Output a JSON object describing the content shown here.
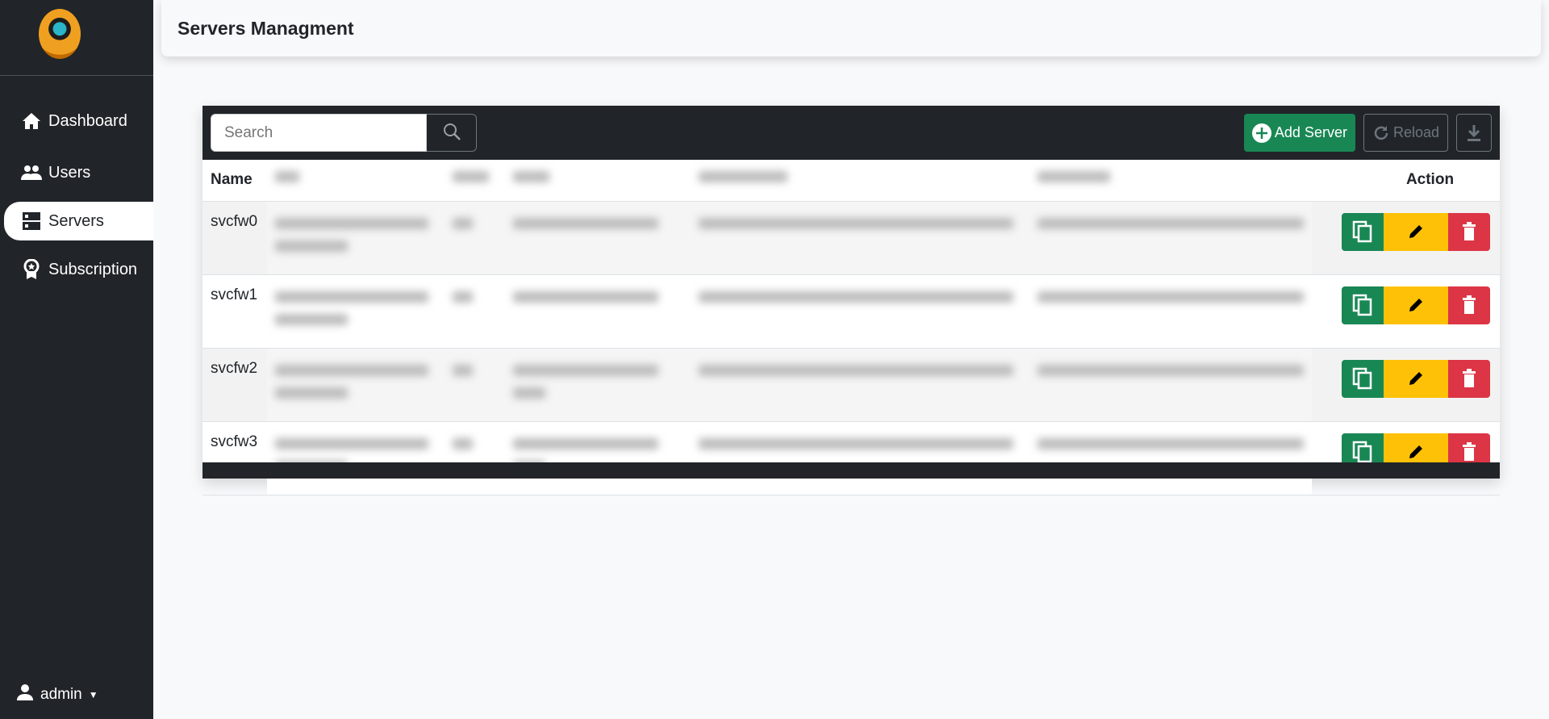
{
  "sidebar": {
    "items": [
      {
        "label": "Dashboard",
        "icon": "home-icon"
      },
      {
        "label": "Users",
        "icon": "users-icon"
      },
      {
        "label": "Servers",
        "icon": "server-icon",
        "active": true
      },
      {
        "label": "Subscription",
        "icon": "award-icon"
      }
    ],
    "user": "admin"
  },
  "header": {
    "title": "Servers Managment"
  },
  "toolbar": {
    "search_placeholder": "Search",
    "add_label": "Add Server",
    "reload_label": "Reload"
  },
  "table": {
    "headers": {
      "name": "Name",
      "action": "Action"
    },
    "rows": [
      {
        "name": "svcfw0"
      },
      {
        "name": "svcfw1"
      },
      {
        "name": "svcfw2"
      },
      {
        "name": "svcfw3"
      }
    ]
  },
  "colors": {
    "sidebar": "#212529",
    "success": "#198754",
    "warning": "#ffc107",
    "danger": "#dc3545"
  }
}
